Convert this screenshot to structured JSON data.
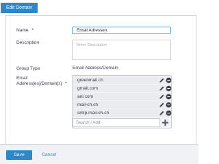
{
  "toolbar": {
    "title_button": "Edit Domain"
  },
  "form": {
    "name_label": "Name",
    "name_required": "*",
    "name_value": "Email Adressen",
    "description_label": "Description",
    "description_placeholder": "Enter Description",
    "group_type_label": "Group Type",
    "group_type_value": "Email Address/Domain",
    "addresses_label_line1": "Email",
    "addresses_label_line2": "Address[es]/Domain[s]",
    "addresses_required": "*",
    "addresses": [
      "greenmail.ch",
      "gmail.com",
      "aol.com",
      "mail-ch.ch",
      "smtp.mail-ch.ch"
    ],
    "search_placeholder": "Search / Add"
  },
  "footer": {
    "save_label": "Save",
    "cancel_label": "Cancel"
  },
  "colors": {
    "accent": "#2f86c9",
    "input_focus_border": "#5c9ad6",
    "list_item_bg": "#eaecef",
    "footer_bg": "#f0f2f5",
    "icon_dark": "#3a3f45"
  },
  "icons": {
    "edit": "pencil-icon",
    "remove": "minus-circle-icon",
    "add": "plus-icon"
  }
}
